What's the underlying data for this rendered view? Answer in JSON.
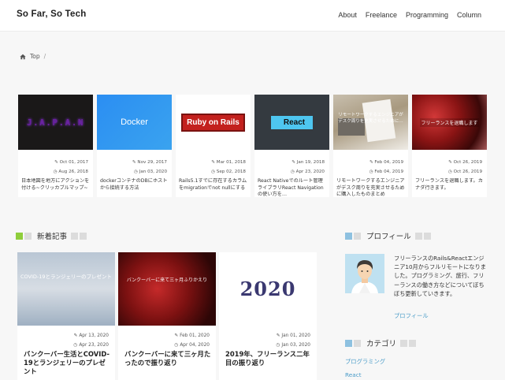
{
  "header": {
    "site_title": "So Far, So Tech",
    "nav": [
      "About",
      "Freelance",
      "Programming",
      "Column"
    ]
  },
  "breadcrumb": {
    "home_label": "Top",
    "separator": "/"
  },
  "carousel": [
    {
      "thumb_text": "J.A.P.A.N",
      "updated": "Oct 01, 2017",
      "published": "Aug 26, 2018",
      "title": "日本地図を地方にアクションを付ける~クリッカブルマップ~"
    },
    {
      "thumb_text": "Docker",
      "updated": "Nov 29, 2017",
      "published": "Jan 03, 2020",
      "title": "dockerコンテナのDBにホストから接続する方法"
    },
    {
      "thumb_text": "Ruby on Rails",
      "updated": "Mar 01, 2018",
      "published": "Sep 02, 2018",
      "title": "Rails5.1すでに存在するカラムをmigrationでnot nullにする"
    },
    {
      "thumb_text": "React",
      "updated": "Jan 19, 2018",
      "published": "Apr 23, 2020",
      "title": "React Nativeでのルート管理ライブラリReact Navigationの使い方を…"
    },
    {
      "thumb_text": "リモートワークするエンジニアがデスク周りを充実させるために…",
      "updated": "Feb 04, 2019",
      "published": "Feb 04, 2019",
      "title": "リモートワークするエンジニアがデスク周りを充実させるために購入したものまとめ"
    },
    {
      "thumb_text": "フリーランスを退職します",
      "updated": "Oct 26, 2019",
      "published": "Oct 26, 2019",
      "title": "フリーランスを退職します。カナダ行きます。"
    }
  ],
  "new_articles": {
    "heading": "新着記事",
    "items": [
      {
        "thumb_text": "COVID-19とランジェリーのプレゼント",
        "updated": "Apr 13, 2020",
        "published": "Apr 23, 2020",
        "title": "バンクーバー生活とCOVID-19とランジェリーのプレゼント"
      },
      {
        "thumb_text": "バンクーバーに来て三ヶ月ふりかえり",
        "updated": "Feb 01, 2020",
        "published": "Apr 04, 2020",
        "title": "バンクーバーに来て三ヶ月たったので振り返り"
      },
      {
        "thumb_text": "2020",
        "updated": "Jan 01, 2020",
        "published": "Jan 03, 2020",
        "title": "2019年、フリーランス二年目の振り返り"
      }
    ]
  },
  "profile": {
    "heading": "プロフィール",
    "text": "フリーランスのRails&Reactエンジニア10月からフルリモートになりました。プログラミング、旅行、フリーランスの働き方などについてぼちぼち更新していきます。",
    "link": "プロフィール"
  },
  "categories": {
    "heading": "カテゴリ",
    "items": [
      "プログラミング",
      "React"
    ]
  },
  "colors": {
    "accent_green": "#8fce3c",
    "accent_blue": "#8ec1e0",
    "link_blue": "#4a9cc8"
  }
}
